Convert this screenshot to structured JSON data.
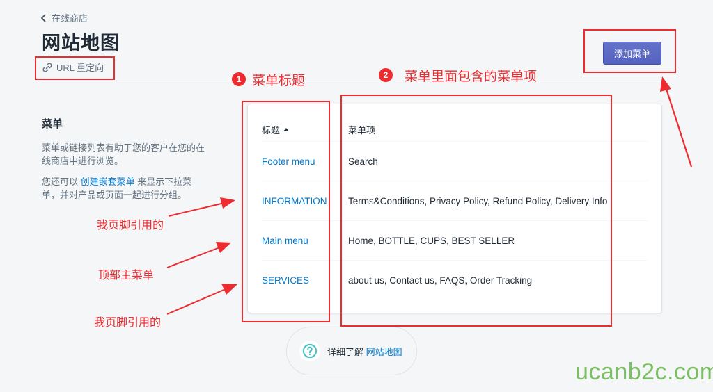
{
  "header": {
    "breadcrumb": "在线商店",
    "title": "网站地图",
    "url_redirect": "URL 重定向",
    "add_menu_button": "添加菜单"
  },
  "section": {
    "title": "菜单",
    "description": "菜单或链接列表有助于您的客户在您的在线商店中进行浏览。",
    "nested_prefix": "您还可以 ",
    "nested_link": "创建嵌套菜单",
    "nested_suffix": " 来显示下拉菜单，并对产品或页面一起进行分组。"
  },
  "table": {
    "columns": [
      "标题",
      "菜单项"
    ],
    "sort_indicator": "ascending",
    "rows": [
      {
        "title": "Footer menu",
        "items": "Search"
      },
      {
        "title": "INFORMATION",
        "items": "Terms&Conditions, Privacy Policy, Refund Policy, Delivery Info"
      },
      {
        "title": "Main menu",
        "items": "Home, BOTTLE, CUPS, BEST SELLER"
      },
      {
        "title": "SERVICES",
        "items": "about us, Contact us, FAQS, Order Tracking"
      }
    ]
  },
  "help": {
    "prefix": "详细了解",
    "link": "网站地图"
  },
  "annotations": {
    "badge1": "1",
    "label1": "菜单标题",
    "badge2": "2",
    "label2": "菜单里面包含的菜单项",
    "arrow_note_1": "我页脚引用的",
    "arrow_note_2": "顶部主菜单",
    "arrow_note_3": "我页脚引用的",
    "color": "#ee2b2f"
  },
  "watermark": "ucanb2c.com",
  "colors": {
    "primary_button": "#5c6ac4",
    "link": "#007ace",
    "background": "#f4f6f8",
    "help_icon": "#47c1bf",
    "watermark": "#7cbf62"
  }
}
